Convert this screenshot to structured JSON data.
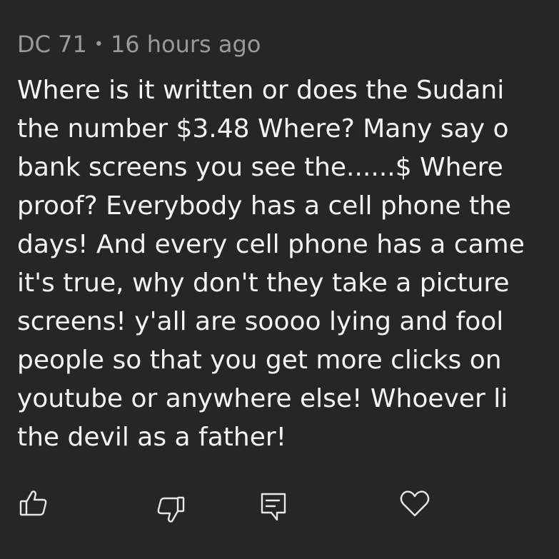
{
  "comment": {
    "author": "DC 71",
    "separator": "•",
    "timestamp": "16 hours ago",
    "body_lines": [
      "Where is it written or does the Sudani",
      "the number $3.48 Where? Many say o",
      "bank screens you see the......$ Where",
      "proof? Everybody has a cell phone the",
      "days! And every cell phone has a came",
      "it's true, why don't they take a picture",
      "screens! y'all are soooo lying and fool",
      "people so that you get more clicks on",
      "youtube or anywhere else! Whoever li",
      "the devil as a father!"
    ]
  },
  "actions": {
    "icons": [
      "thumbs-up-icon",
      "thumbs-down-icon",
      "reply-icon",
      "heart-icon"
    ]
  },
  "colors": {
    "background": "#262626",
    "text": "#f4f4f4",
    "meta": "#9a9a9a",
    "icon": "#e8e8e8"
  }
}
